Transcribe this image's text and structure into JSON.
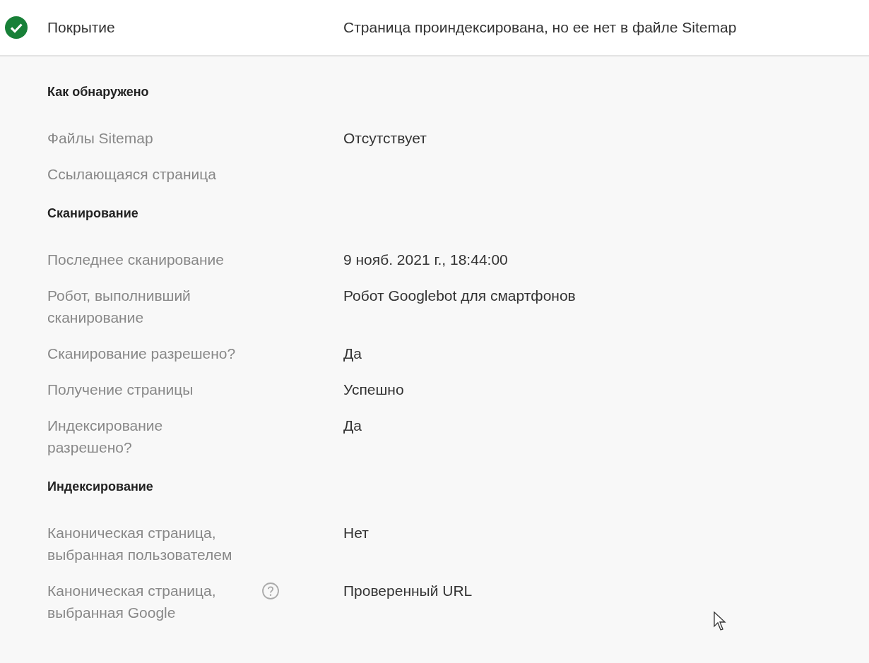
{
  "header": {
    "passed": true,
    "label": "Покрытие",
    "value": "Страница проиндексирована, но ее нет в файле Sitemap"
  },
  "sections": [
    {
      "heading": "Как обнаружено",
      "rows": [
        {
          "label": "Файлы Sitemap",
          "value": "Отсутствует",
          "help": false
        },
        {
          "label": "Ссылающаяся страница",
          "help": false
        }
      ]
    },
    {
      "heading": "Сканирование",
      "rows": [
        {
          "label": "Последнее сканирование",
          "value": "9 нояб. 2021 г., 18:44:00",
          "help": false
        },
        {
          "label": "Робот, выполнивший сканирование",
          "value": "Робот Googlebot для смартфонов",
          "help": false
        },
        {
          "label": "Сканирование разрешено?",
          "value": "Да",
          "help": false
        },
        {
          "label": "Получение страницы",
          "value": "Успешно",
          "help": false
        },
        {
          "label": "Индексирование разрешено?",
          "value": "Да",
          "help": false
        }
      ]
    },
    {
      "heading": "Индексирование",
      "rows": [
        {
          "label": "Каноническая страница, выбранная пользователем",
          "value": "Нет",
          "help": false
        },
        {
          "label": "Каноническая страница, выбранная Google",
          "value": "Проверенный URL",
          "help": true
        }
      ]
    }
  ]
}
